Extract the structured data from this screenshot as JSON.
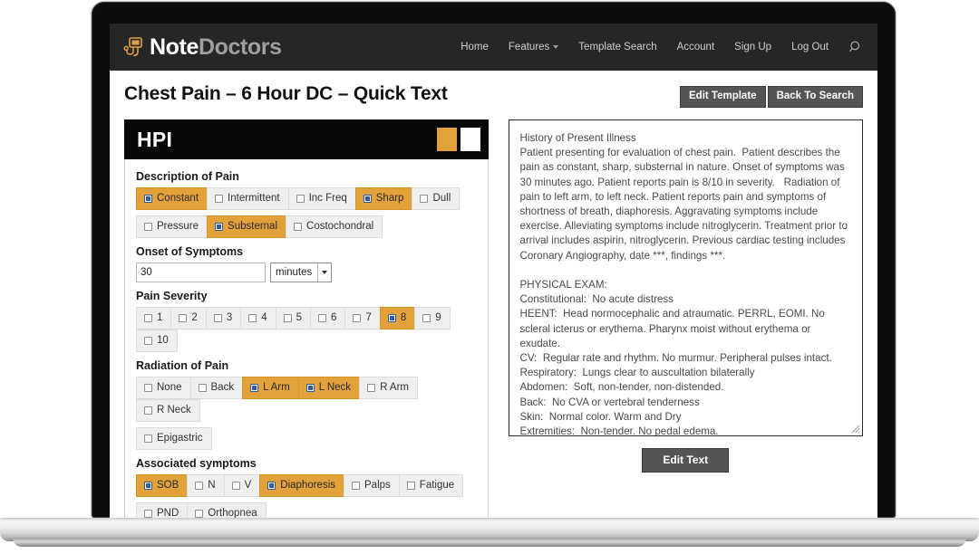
{
  "brand": {
    "name_bold": "Note",
    "name_light": "Doctors",
    "logo_icon": "stethoscope-monitor-icon"
  },
  "nav": {
    "items": [
      {
        "label": "Home",
        "has_caret": false
      },
      {
        "label": "Features",
        "has_caret": true
      },
      {
        "label": "Template Search",
        "has_caret": false
      },
      {
        "label": "Account",
        "has_caret": false
      },
      {
        "label": "Sign Up",
        "has_caret": false
      },
      {
        "label": "Log Out",
        "has_caret": false
      }
    ],
    "search_icon": "search-icon"
  },
  "page": {
    "title": "Chest Pain – 6 Hour DC – Quick Text",
    "edit_template_label": "Edit Template",
    "back_to_search_label": "Back To Search"
  },
  "hpi": {
    "title": "HPI",
    "toggle_on_color": "#e3a13c",
    "toggle_off_color": "#ffffff",
    "accent_color": "#e3a13c"
  },
  "form": {
    "description_of_pain": {
      "label": "Description of Pain",
      "rows": [
        [
          {
            "label": "Constant",
            "checked": true
          },
          {
            "label": "Intermittent",
            "checked": false
          },
          {
            "label": "Inc Freq",
            "checked": false
          },
          {
            "label": "Sharp",
            "checked": true
          },
          {
            "label": "Dull",
            "checked": false
          }
        ],
        [
          {
            "label": "Pressure",
            "checked": false
          },
          {
            "label": "Substernal",
            "checked": true
          },
          {
            "label": "Costochondral",
            "checked": false
          }
        ]
      ]
    },
    "onset": {
      "label": "Onset of Symptoms",
      "value": "30",
      "unit_selected": "minutes"
    },
    "pain_severity": {
      "label": "Pain Severity",
      "rows": [
        [
          {
            "label": "1",
            "checked": false
          },
          {
            "label": "2",
            "checked": false
          },
          {
            "label": "3",
            "checked": false
          },
          {
            "label": "4",
            "checked": false
          },
          {
            "label": "5",
            "checked": false
          },
          {
            "label": "6",
            "checked": false
          },
          {
            "label": "7",
            "checked": false
          },
          {
            "label": "8",
            "checked": true
          },
          {
            "label": "9",
            "checked": false
          },
          {
            "label": "10",
            "checked": false
          }
        ]
      ]
    },
    "radiation_of_pain": {
      "label": "Radiation of Pain",
      "rows": [
        [
          {
            "label": "None",
            "checked": false
          },
          {
            "label": "Back",
            "checked": false
          },
          {
            "label": "L Arm",
            "checked": true
          },
          {
            "label": "L Neck",
            "checked": true
          },
          {
            "label": "R Arm",
            "checked": false
          },
          {
            "label": "R Neck",
            "checked": false
          }
        ],
        [
          {
            "label": "Epigastric",
            "checked": false
          }
        ]
      ]
    },
    "associated_symptoms": {
      "label": "Associated symptoms",
      "rows": [
        [
          {
            "label": "SOB",
            "checked": true
          },
          {
            "label": "N",
            "checked": false
          },
          {
            "label": "V",
            "checked": false
          },
          {
            "label": "Diaphoresis",
            "checked": true
          },
          {
            "label": "Palps",
            "checked": false
          },
          {
            "label": "Fatigue",
            "checked": false
          }
        ],
        [
          {
            "label": "PND",
            "checked": false
          },
          {
            "label": "Orthopnea",
            "checked": false
          }
        ]
      ]
    }
  },
  "note": {
    "content": "History of Present Illness\nPatient presenting for evaluation of chest pain.  Patient describes the pain as constant, sharp, substernal in nature. Onset of symptoms was 30 minutes ago. Patient reports pain is 8/10 in severity.   Radiation of pain to left arm, to left neck. Patient reports pain and symptoms of shortness of breath, diaphoresis. Aggravating symptoms include exercise. Alleviating symptoms include nitroglycerin. Treatment prior to arrival includes aspirin, nitroglycerin. Previous cardiac testing includes Coronary Angiography, date ***, findings ***.\n\nPHYSICAL EXAM:\nConstitutional:  No acute distress\nHEENT:  Head normocephalic and atraumatic. PERRL, EOMI. No scleral icterus or erythema. Pharynx moist without erythema or exudate.\nCV:  Regular rate and rhythm. No murmur. Peripheral pulses intact.\nRespiratory:  Lungs clear to auscultation bilaterally\nAbdomen:  Soft, non-tender, non-distended.\nBack:  No CVA or vertebral tenderness\nSkin:  Normal color. Warm and Dry\nExtremities:  Non-tender. No pedal edema.",
    "edit_text_label": "Edit Text"
  }
}
